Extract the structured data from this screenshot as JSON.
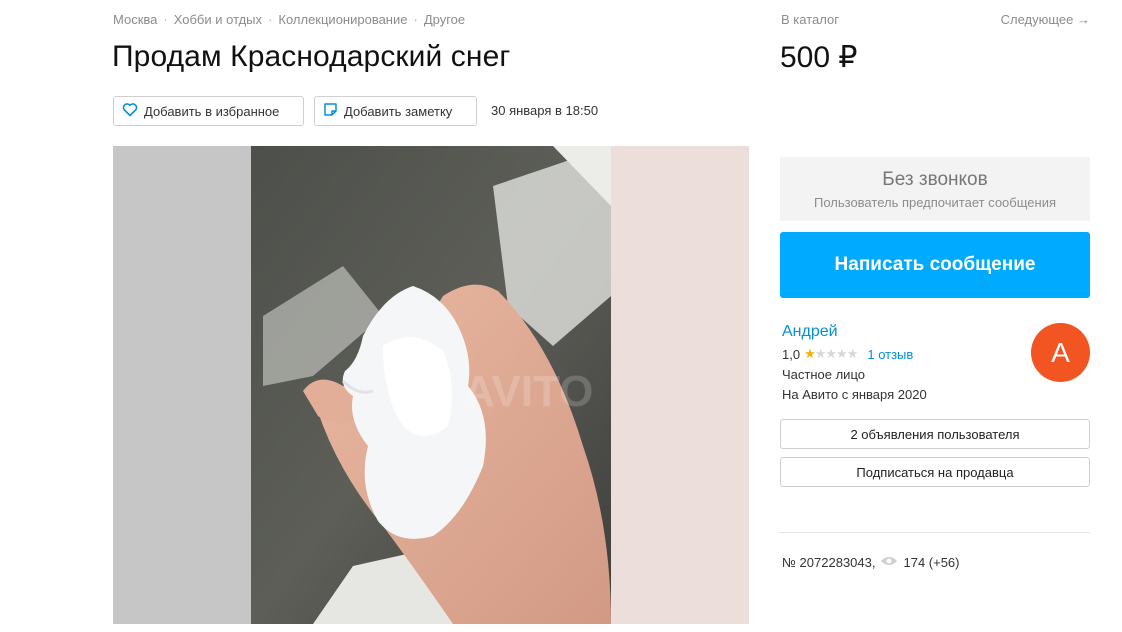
{
  "breadcrumb": {
    "items": [
      "Москва",
      "Хобби и отдых",
      "Коллекционирование",
      "Другое"
    ],
    "sep": "·"
  },
  "catalog_link": "В каталог",
  "next_link": "Следующее →",
  "listing": {
    "title": "Продам Краснодарский снег",
    "price": "500 ₽",
    "date": "30 января в 18:50",
    "id_text": "№ 2072283043,",
    "views": "174 (+56)"
  },
  "actions": {
    "favorite_label": "Добавить в избранное",
    "note_label": "Добавить заметку"
  },
  "contact": {
    "no_calls_title": "Без звонков",
    "no_calls_sub": "Пользователь предпочитает сообщения",
    "message_button": "Написать сообщение"
  },
  "seller": {
    "name": "Андрей",
    "rating": "1,0",
    "stars_filled": 1,
    "stars_total": 5,
    "reviews": "1 отзыв",
    "type": "Частное лицо",
    "since": "На Авито с января 2020",
    "avatar_letter": "А",
    "avatar_color": "#f25522",
    "ads_button": "2 объявления пользователя",
    "subscribe_button": "Подписаться на продавца"
  },
  "photo": {
    "watermark": "AVITO"
  },
  "colors": {
    "accent": "#00aaff",
    "link": "#0091d9",
    "star": "#f5b100"
  },
  "icons": [
    "heart-icon",
    "note-icon",
    "eye-icon",
    "star-icon"
  ]
}
